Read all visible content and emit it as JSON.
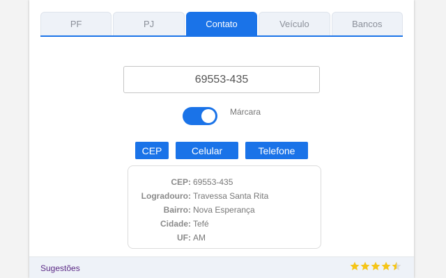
{
  "tabs": [
    {
      "label": "PF",
      "active": false
    },
    {
      "label": "PJ",
      "active": false
    },
    {
      "label": "Contato",
      "active": true
    },
    {
      "label": "Veículo",
      "active": false
    },
    {
      "label": "Bancos",
      "active": false
    }
  ],
  "cep_input": {
    "value": "69553-435"
  },
  "toggle": {
    "label": "Márcara",
    "on": true
  },
  "buttons": {
    "cep": "CEP",
    "celular": "Celular",
    "telefone": "Telefone"
  },
  "result": [
    {
      "key": "CEP:",
      "value": "69553-435"
    },
    {
      "key": "Logradouro:",
      "value": "Travessa Santa Rita"
    },
    {
      "key": "Bairro:",
      "value": "Nova Esperança"
    },
    {
      "key": "Cidade:",
      "value": "Tefé"
    },
    {
      "key": "UF:",
      "value": "AM"
    }
  ],
  "footer": {
    "suggestions_label": "Sugestões",
    "rating": 4.5
  },
  "colors": {
    "accent": "#1a73e8",
    "star": "#f5c518",
    "link": "#5b2a86"
  }
}
